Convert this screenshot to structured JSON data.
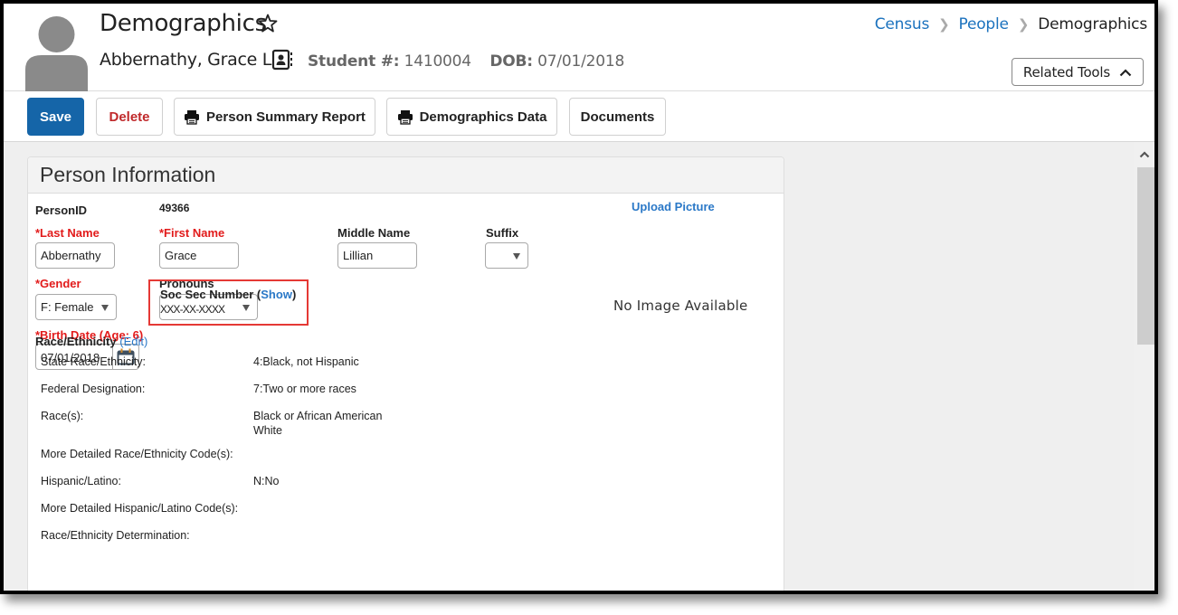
{
  "header": {
    "title": "Demographics",
    "person_name": "Abbernathy, Grace L",
    "student_number_label": "Student #:",
    "student_number": "1410004",
    "dob_label": "DOB:",
    "dob": "07/01/2018",
    "icons": {
      "favorite": "star-outline-icon",
      "contact": "contact-card-icon",
      "avatar": "person-silhouette-icon"
    }
  },
  "breadcrumb": {
    "items": [
      {
        "label": "Census",
        "link": true
      },
      {
        "label": "People",
        "link": true
      },
      {
        "label": "Demographics",
        "link": false
      }
    ],
    "separator": ">"
  },
  "related_tools": {
    "label": "Related Tools",
    "icon": "chevron-up-icon"
  },
  "toolbar": {
    "save_label": "Save",
    "delete_label": "Delete",
    "person_summary_label": "Person Summary Report",
    "demographics_data_label": "Demographics Data",
    "documents_label": "Documents"
  },
  "colors": {
    "primary": "#1565a8",
    "danger": "#c0292b",
    "required_label": "#e21b1b",
    "link": "#1b72be",
    "highlight_box": "#e53935"
  },
  "person_info": {
    "title": "Person Information",
    "person_id_label": "PersonID",
    "person_id": "49366",
    "last_name_label": "*Last Name",
    "last_name": "Abbernathy",
    "first_name_label": "*First Name",
    "first_name": "Grace",
    "middle_name_label": "Middle Name",
    "middle_name": "Lillian",
    "suffix_label": "Suffix",
    "suffix": "",
    "upload_picture": "Upload Picture",
    "gender_label": "*Gender",
    "gender": "F: Female",
    "pronouns_label": "Pronouns",
    "pronouns": "",
    "birth_date_label": "*Birth Date (Age: 6)",
    "birth_date": "07/01/2018",
    "ssn_label": "Soc Sec Number (",
    "ssn_show": "Show",
    "ssn_close": ")",
    "ssn_value": "XXX-XX-XXXX",
    "no_image": "No Image Available"
  },
  "race": {
    "heading": "Race/Ethnicity",
    "edit_open": "(",
    "edit_label": "Edit",
    "edit_close": ")",
    "rows": [
      {
        "label": "State Race/Ethnicity:",
        "value": "4:Black, not Hispanic"
      },
      {
        "label": "Federal Designation:",
        "value": "7:Two or more races"
      },
      {
        "label": "Race(s):",
        "value": "Black or African American",
        "value2": "White"
      },
      {
        "label": "More Detailed Race/Ethnicity Code(s):",
        "value": ""
      },
      {
        "label": "Hispanic/Latino:",
        "value": "N:No"
      },
      {
        "label": "More Detailed Hispanic/Latino Code(s):",
        "value": ""
      },
      {
        "label": "Race/Ethnicity Determination:",
        "value": ""
      }
    ]
  }
}
